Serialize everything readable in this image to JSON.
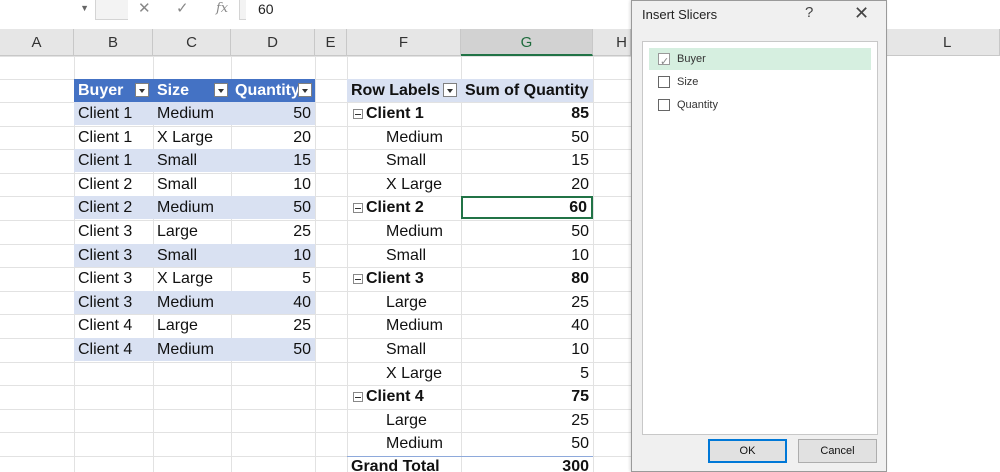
{
  "formula_bar": {
    "fx": "fx",
    "cancel": "✕",
    "enter": "✓",
    "value": "60"
  },
  "columns": [
    "A",
    "B",
    "C",
    "D",
    "E",
    "F",
    "G",
    "H",
    "L"
  ],
  "table": {
    "headers": [
      "Buyer",
      "Size",
      "Quantity"
    ],
    "rows": [
      [
        "Client 1",
        "Medium",
        "50"
      ],
      [
        "Client 1",
        "X Large",
        "20"
      ],
      [
        "Client 1",
        "Small",
        "15"
      ],
      [
        "Client 2",
        "Small",
        "10"
      ],
      [
        "Client 2",
        "Medium",
        "50"
      ],
      [
        "Client 3",
        "Large",
        "25"
      ],
      [
        "Client 3",
        "Small",
        "10"
      ],
      [
        "Client 3",
        "X Large",
        "5"
      ],
      [
        "Client 3",
        "Medium",
        "40"
      ],
      [
        "Client 4",
        "Large",
        "25"
      ],
      [
        "Client 4",
        "Medium",
        "50"
      ]
    ]
  },
  "pivot": {
    "header_label": "Row Labels",
    "header_value": "Sum of Quantity",
    "rows": [
      {
        "label": "Client 1",
        "value": "85",
        "group": true
      },
      {
        "label": "Medium",
        "value": "50",
        "group": false
      },
      {
        "label": "Small",
        "value": "15",
        "group": false
      },
      {
        "label": "X Large",
        "value": "20",
        "group": false
      },
      {
        "label": "Client 2",
        "value": "60",
        "group": true
      },
      {
        "label": "Medium",
        "value": "50",
        "group": false
      },
      {
        "label": "Small",
        "value": "10",
        "group": false
      },
      {
        "label": "Client 3",
        "value": "80",
        "group": true
      },
      {
        "label": "Large",
        "value": "25",
        "group": false
      },
      {
        "label": "Medium",
        "value": "40",
        "group": false
      },
      {
        "label": "Small",
        "value": "10",
        "group": false
      },
      {
        "label": "X Large",
        "value": "5",
        "group": false
      },
      {
        "label": "Client 4",
        "value": "75",
        "group": true
      },
      {
        "label": "Large",
        "value": "25",
        "group": false
      },
      {
        "label": "Medium",
        "value": "50",
        "group": false
      }
    ],
    "grand_total_label": "Grand Total",
    "grand_total_value": "300"
  },
  "dialog": {
    "title": "Insert Slicers",
    "help": "?",
    "close": "✕",
    "options": [
      {
        "label": "Buyer",
        "checked": true
      },
      {
        "label": "Size",
        "checked": false
      },
      {
        "label": "Quantity",
        "checked": false
      }
    ],
    "ok": "OK",
    "cancel": "Cancel"
  },
  "colors": {
    "table_header": "#4472c4",
    "band": "#d9e1f2",
    "excel_green": "#217346",
    "selected_option": "#d6efe0"
  }
}
